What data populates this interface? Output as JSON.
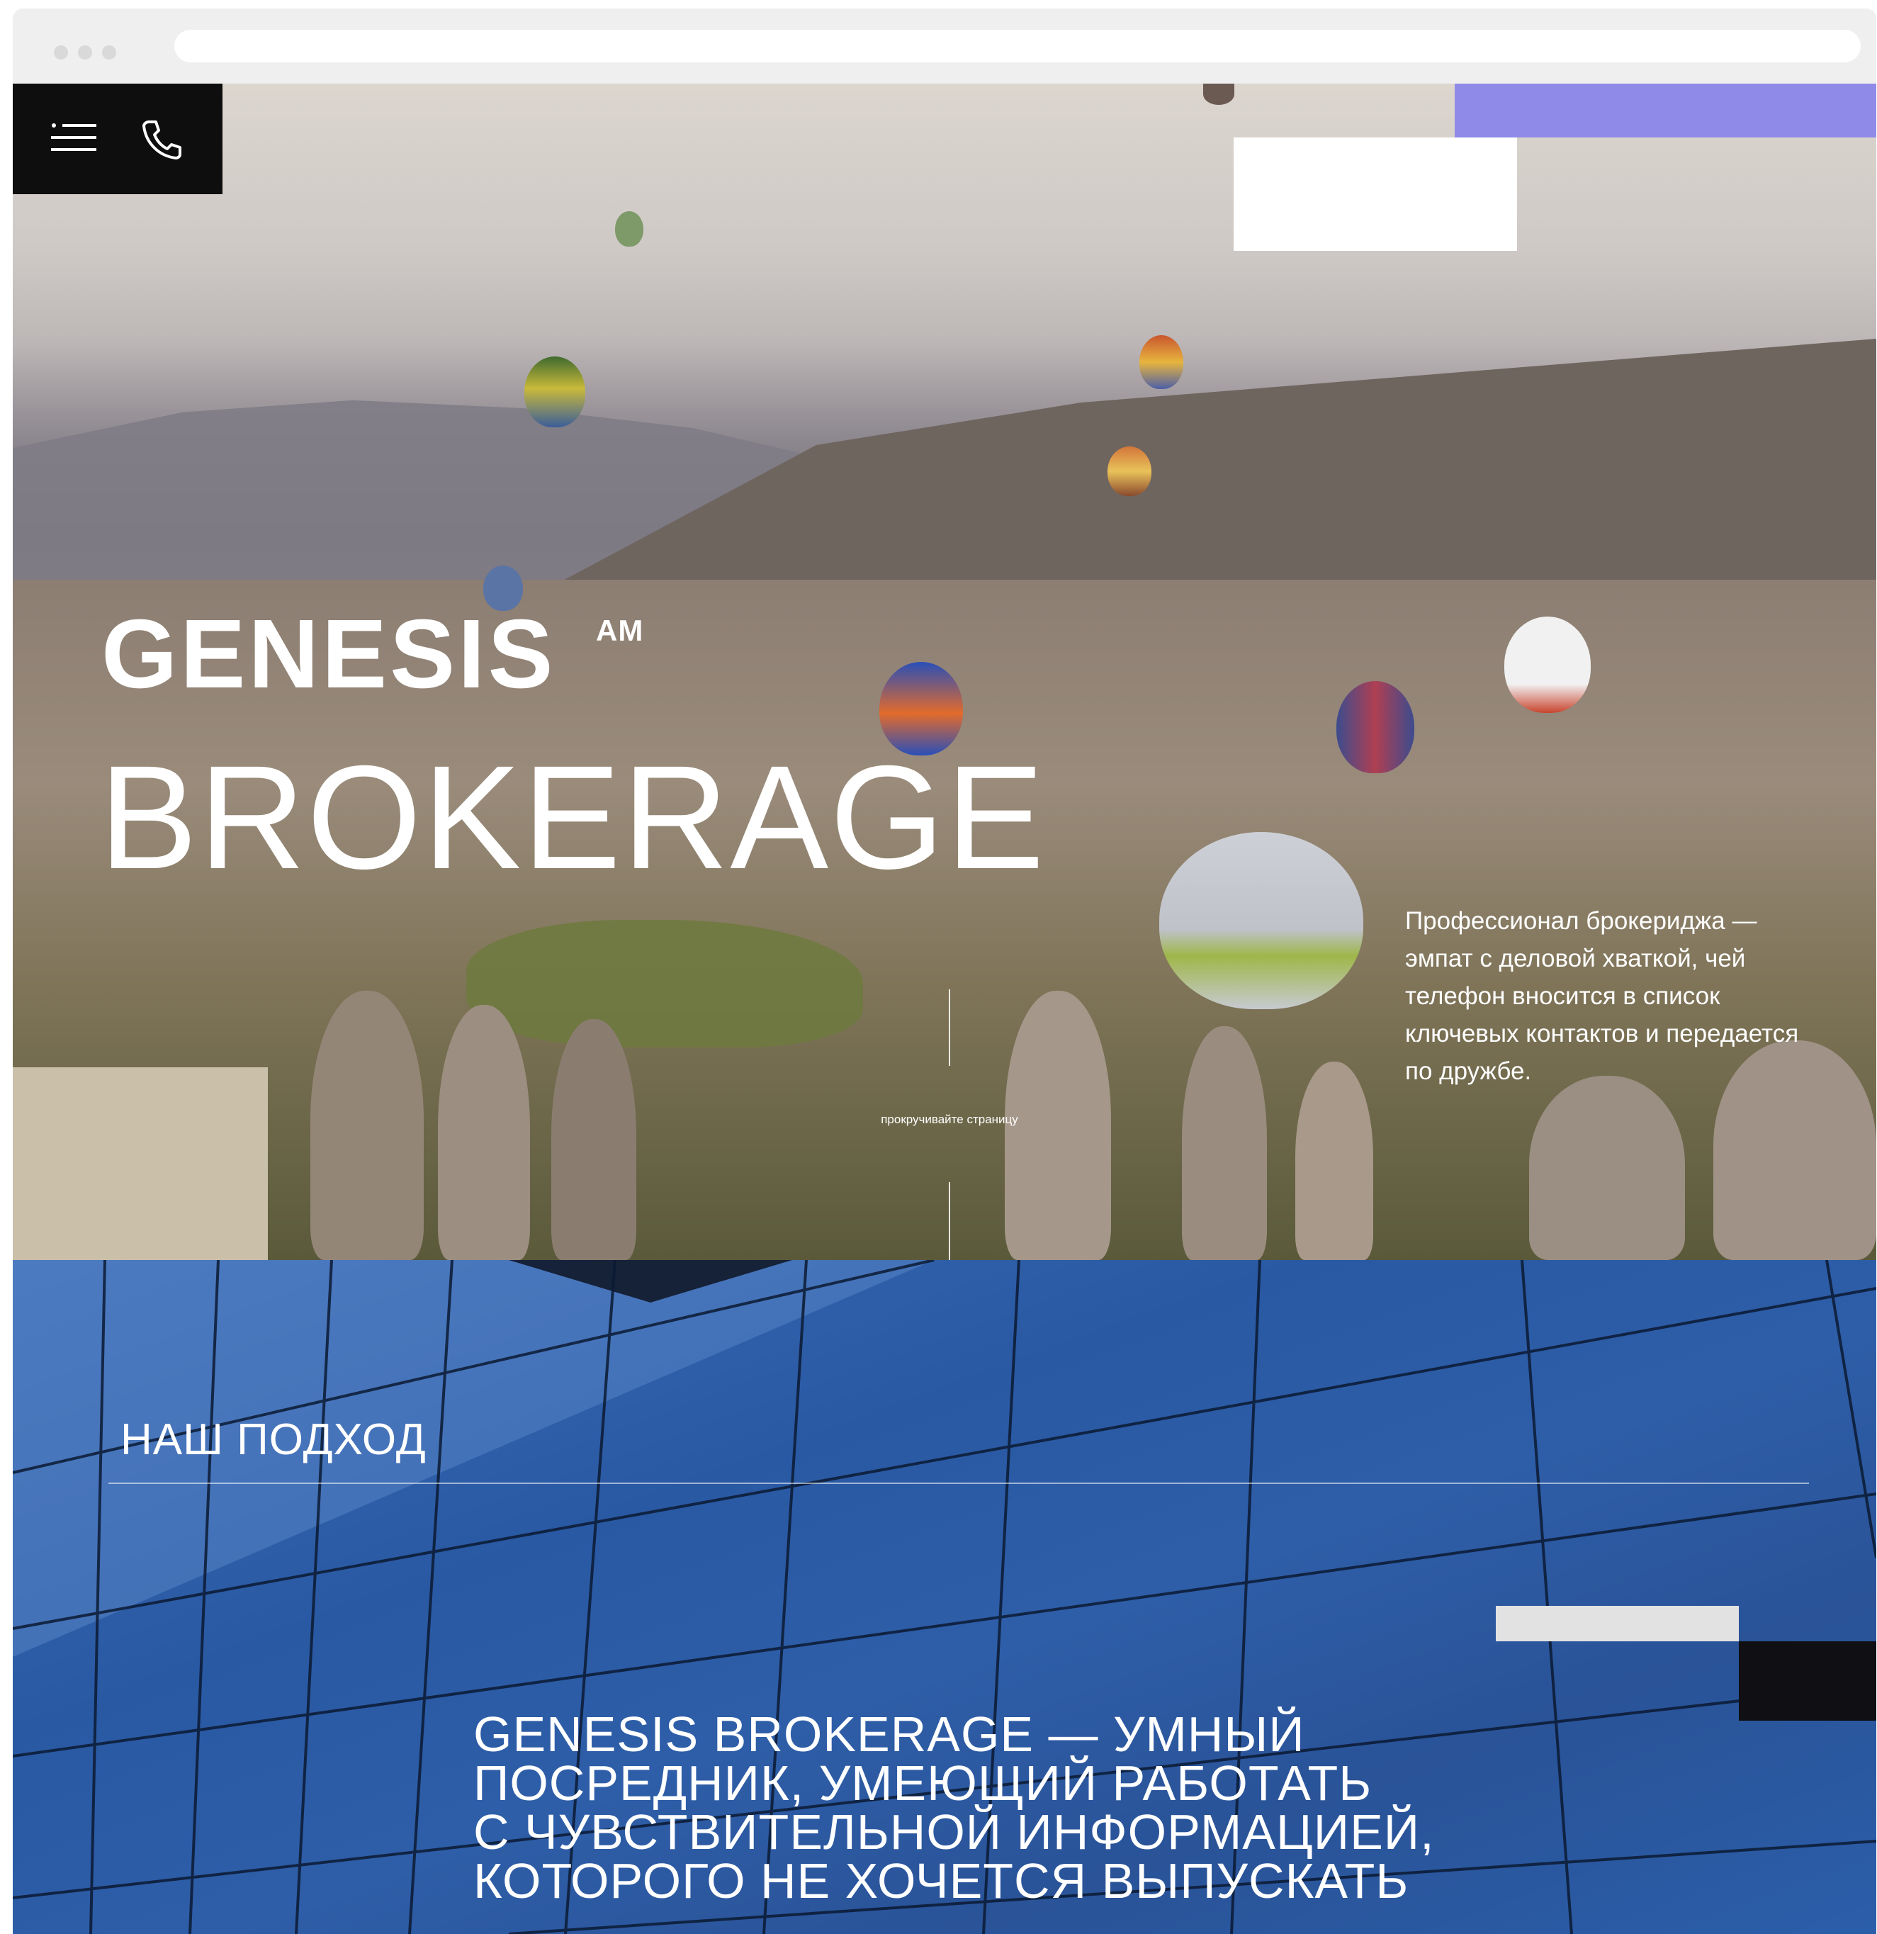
{
  "browser": {
    "address_text": ""
  },
  "brand": {
    "logo_text": "GENESIS",
    "logo_suffix": "AM",
    "wordmark": "BROKERAGE"
  },
  "hero": {
    "description": "Профессионал брокериджа — эмпат с деловой хваткой, чей телефон вносится в список ключевых контактов и передается по дружбе.",
    "scroll_hint": "прокручивайте страницу"
  },
  "approach": {
    "title": "НАШ ПОДХОД",
    "statement_lines": [
      "GENESIS BROKERAGE — УМНЫЙ",
      "ПОСРЕДНИК, УМЕЮЩИЙ РАБОТАТЬ",
      "С ЧУВСТВИТЕЛЬНОЙ ИНФОРМАЦИЕЙ,",
      "КОТОРОГО НЕ ХОЧЕТСЯ ВЫПУСКАТЬ"
    ]
  },
  "icons": {
    "menu": "hamburger-menu-icon",
    "phone": "phone-icon"
  },
  "colors": {
    "accent_purple": "#8f8ae8",
    "beige": "#cabfa8",
    "dark": "#0e0e0e",
    "section_blue": "#2a59a3"
  }
}
